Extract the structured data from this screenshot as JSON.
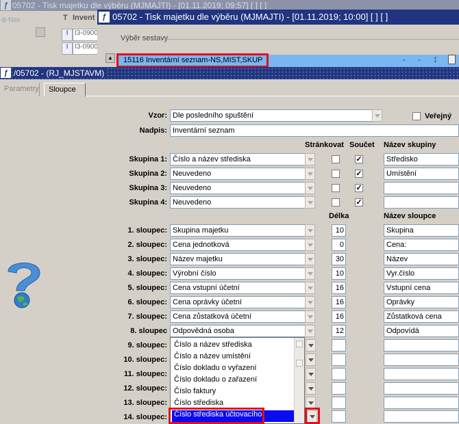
{
  "background_window": {
    "title": "05702 - Tisk majetku dle výběru (MJMAJTI) - [01.11.2019; 09:57]  [ ]  [ ]",
    "nav_label": "Nav",
    "col_t": "T",
    "col_invent": "Invent",
    "rows": [
      {
        "type": "I",
        "code": "I3-0900"
      },
      {
        "type": "I",
        "code": "I3-0900"
      }
    ]
  },
  "middle_dialog": {
    "title": "05702 - Tisk majetku dle výběru (MJMAJTI) - [01.11.2019; 10:00]  [ ]  [ ]",
    "section_label": "Výběr sestavy",
    "selected_report": "15116  Inventární seznam-NS,MIST,SKUP",
    "icons": [
      "dash-icon",
      "dash-icon",
      "sort-updown-icon",
      "pdf-icon"
    ]
  },
  "front_dialog": {
    "title": "/05702 - (RJ_MJSTAVM)",
    "tabs": [
      {
        "label": "Parametry",
        "active": false
      },
      {
        "label": "Sloupce",
        "active": true
      }
    ],
    "vzor_label": "Vzor:",
    "vzor_value": "Dle posledního spuštění",
    "verejny_label": "Veřejný",
    "nadpis_label": "Nadpis:",
    "nadpis_value": "Inventární seznam",
    "col_strankovat": "Stránkovat",
    "col_soucet": "Součet",
    "col_nazev_skupiny": "Název skupiny",
    "groups": [
      {
        "label": "Skupina 1:",
        "value": "Číslo a název střediska",
        "strankovat": false,
        "soucet": true,
        "name": "Středisko"
      },
      {
        "label": "Skupina 2:",
        "value": "Neuvedeno",
        "strankovat": false,
        "soucet": true,
        "name": "Umístění"
      },
      {
        "label": "Skupina 3:",
        "value": "Neuvedeno",
        "strankovat": false,
        "soucet": true,
        "name": ""
      },
      {
        "label": "Skupina 4:",
        "value": "Neuvedeno",
        "strankovat": false,
        "soucet": true,
        "name": ""
      }
    ],
    "col_delka": "Délka",
    "col_nazev_sloupce": "Název sloupce",
    "columns": [
      {
        "label": "1. sloupec:",
        "value": "Skupina majetku",
        "length": "10",
        "name": "Skupina"
      },
      {
        "label": "2. sloupec:",
        "value": "Cena jednotková",
        "length": "0",
        "name": "Cena:"
      },
      {
        "label": "3. sloupec:",
        "value": "Název majetku",
        "length": "30",
        "name": "Název"
      },
      {
        "label": "4. sloupec:",
        "value": "Výrobní číslo",
        "length": "10",
        "name": "Vyr.číslo"
      },
      {
        "label": "5. sloupec:",
        "value": "Cena vstupní účetní",
        "length": "16",
        "name": "Vstupní cena"
      },
      {
        "label": "6. sloupec:",
        "value": "Cena oprávky účetní",
        "length": "16",
        "name": "Oprávky"
      },
      {
        "label": "7. sloupec:",
        "value": "Cena zůstatková účetní",
        "length": "16",
        "name": "Zůstatková cena"
      },
      {
        "label": "8. sloupec",
        "value": "Odpovědná osoba",
        "length": "12",
        "name": "Odpovídá"
      },
      {
        "label": "9. sloupec:",
        "value": "",
        "length": "",
        "name": ""
      },
      {
        "label": "10. sloupec:",
        "value": "",
        "length": "",
        "name": ""
      },
      {
        "label": "11. sloupec:",
        "value": "",
        "length": "",
        "name": ""
      },
      {
        "label": "12. sloupec:",
        "value": "",
        "length": "",
        "name": ""
      },
      {
        "label": "13. sloupec:",
        "value": "",
        "length": "",
        "name": ""
      },
      {
        "label": "14. sloupec:",
        "value": "Číslo střediska účtovacího",
        "length": "",
        "name": ""
      }
    ],
    "dropdown_options": [
      "Číslo a název střediska",
      "Číslo a název umístění",
      "Číslo dokladu o vyřazení",
      "Číslo dokladu o zařazení",
      "Číslo faktury",
      "Číslo střediska",
      "Číslo střediska účtovacího"
    ],
    "dropdown_selected_index": 6
  },
  "colors": {
    "title_active": "#203480",
    "title_inactive": "#8c92a8",
    "list_selection": "#7ab6f0",
    "dropdown_selection": "#0b0bf0",
    "highlight_box": "#e01020"
  }
}
